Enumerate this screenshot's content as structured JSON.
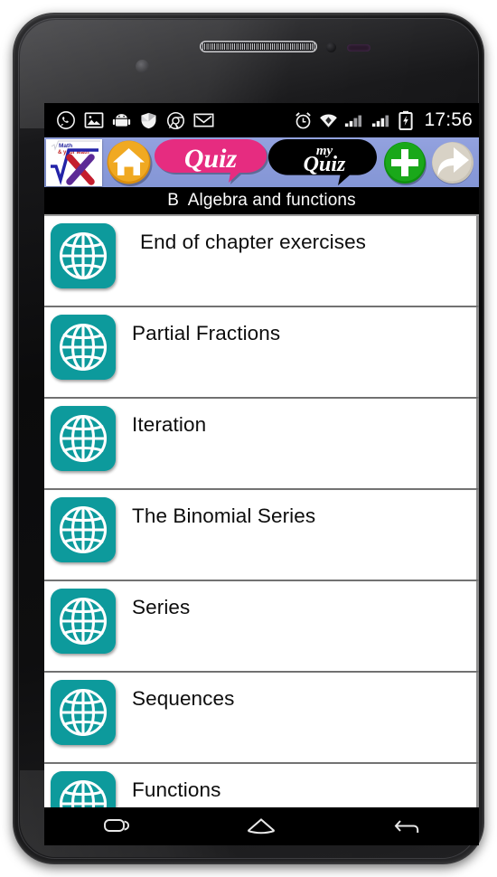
{
  "device": {
    "type": "android-smartphone",
    "frame_color": "#111112"
  },
  "status_bar": {
    "icons_left": [
      {
        "name": "whatsapp-icon",
        "label": "WhatsApp"
      },
      {
        "name": "gallery-icon",
        "label": "Gallery"
      },
      {
        "name": "android-icon",
        "label": "Android"
      },
      {
        "name": "shield-icon",
        "label": "Security"
      },
      {
        "name": "chrome-icon",
        "label": "Browser"
      },
      {
        "name": "gmail-icon",
        "label": "Gmail"
      }
    ],
    "icons_right": [
      {
        "name": "alarm-icon",
        "label": "Alarm"
      },
      {
        "name": "wifi-icon",
        "label": "Wi-Fi"
      },
      {
        "name": "signal-sim1-icon",
        "label": "Signal SIM 1"
      },
      {
        "name": "signal-sim2-icon",
        "label": "Signal SIM 2"
      },
      {
        "name": "battery-charging-icon",
        "label": "Battery charging"
      }
    ],
    "clock": "17:56",
    "background": "#000000",
    "foreground": "#ffffff"
  },
  "toolbar": {
    "background": "#8b9bd9",
    "logo": {
      "name": "app-logo",
      "top_text_line1": "Math",
      "top_text_line2": "& your Math",
      "radical_symbol": "√",
      "letter": "X"
    },
    "home_label": "Home",
    "quiz_label": "Quiz",
    "myquiz_label_top": "my",
    "myquiz_label_bottom": "Quiz",
    "add_label": "Add",
    "forward_label": "Forward",
    "colors": {
      "home": "#efa61f",
      "quiz": "#e72b7f",
      "myquiz": "#000000",
      "add": "#18a818",
      "forward": "#cfc9bc"
    }
  },
  "title_bar": {
    "text": "B  Algebra and functions",
    "background": "#000000",
    "color": "#ffffff"
  },
  "list": {
    "icon_color": "#0c9597",
    "items": [
      {
        "label": "End of chapter exercises",
        "icon": "globe-icon",
        "indented": true
      },
      {
        "label": "Partial Fractions",
        "icon": "globe-icon",
        "indented": false
      },
      {
        "label": "Iteration",
        "icon": "globe-icon",
        "indented": false
      },
      {
        "label": "The Binomial Series",
        "icon": "globe-icon",
        "indented": false
      },
      {
        "label": "Series",
        "icon": "globe-icon",
        "indented": false
      },
      {
        "label": "Sequences",
        "icon": "globe-icon",
        "indented": false
      },
      {
        "label": "Functions",
        "icon": "globe-icon",
        "indented": false
      }
    ]
  },
  "nav_bar": {
    "recents_label": "Recent apps",
    "home_label": "Home",
    "back_label": "Back",
    "background": "#000000"
  }
}
